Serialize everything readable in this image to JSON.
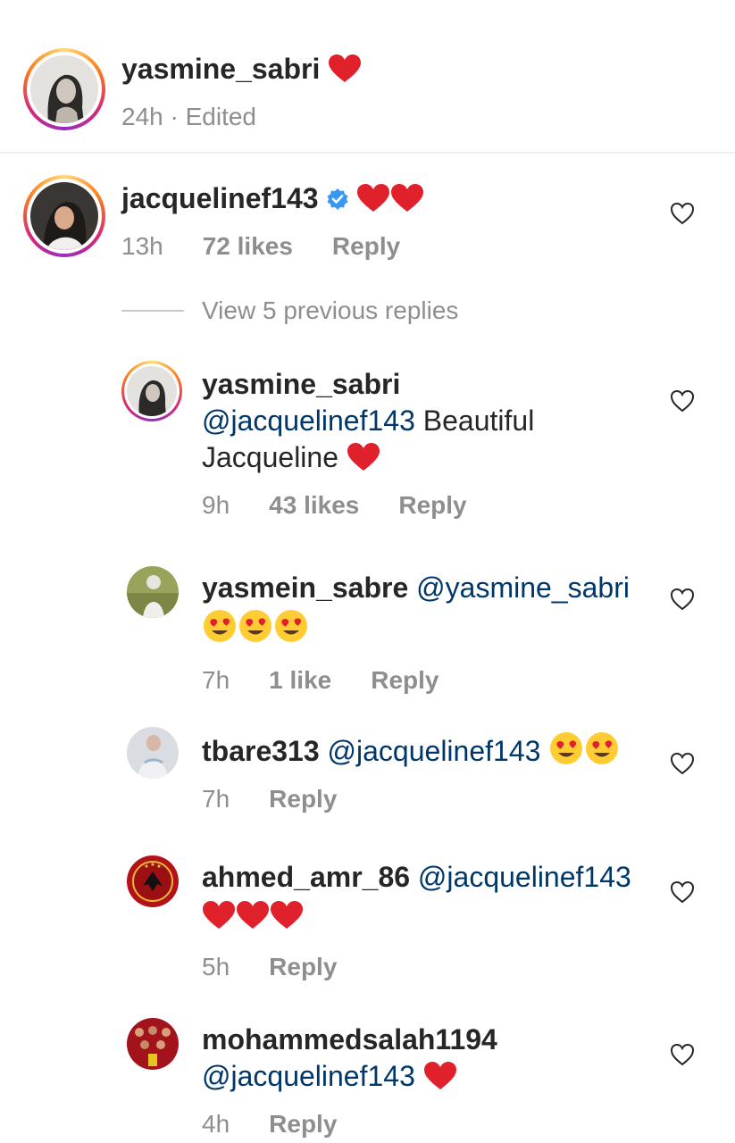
{
  "caption": {
    "username": "yasmine_sabri",
    "time": "24h",
    "separator": "·",
    "edited": "Edited",
    "icons": [
      "red-heart-icon"
    ]
  },
  "top_comment": {
    "username": "jacquelinef143",
    "verified": true,
    "text_icons": [
      "red-heart-icon",
      "red-heart-icon"
    ],
    "time": "13h",
    "likes": "72 likes",
    "reply": "Reply"
  },
  "view_replies_label": "View 5 previous replies",
  "replies": [
    {
      "username": "yasmine_sabri",
      "mention": "@jacquelinef143",
      "text_line1": "Beautiful",
      "text_line2": "Jacqueline",
      "icons": [
        "red-heart-icon"
      ],
      "time": "9h",
      "likes": "43 likes",
      "reply": "Reply"
    },
    {
      "username": "yasmein_sabre",
      "mention": "@yasmine_sabri",
      "icons": [
        "heart-eyes-icon",
        "heart-eyes-icon",
        "heart-eyes-icon"
      ],
      "time": "7h",
      "likes": "1 like",
      "reply": "Reply"
    },
    {
      "username": "tbare313",
      "mention": "@jacquelinef143",
      "icons": [
        "heart-eyes-icon",
        "heart-eyes-icon"
      ],
      "time": "7h",
      "reply": "Reply"
    },
    {
      "username": "ahmed_amr_86",
      "mention": "@jacquelinef143",
      "icons": [
        "red-heart-icon",
        "red-heart-icon",
        "red-heart-icon"
      ],
      "time": "5h",
      "reply": "Reply"
    },
    {
      "username": "mohammedsalah1194",
      "mention": "@jacquelinef143",
      "icons": [
        "red-heart-icon"
      ],
      "time": "4h",
      "reply": "Reply"
    }
  ],
  "colors": {
    "text": "#262626",
    "secondary": "#8e8e8e",
    "mention": "#00376b",
    "heart": "#e0202b",
    "verified": "#3897f0"
  }
}
